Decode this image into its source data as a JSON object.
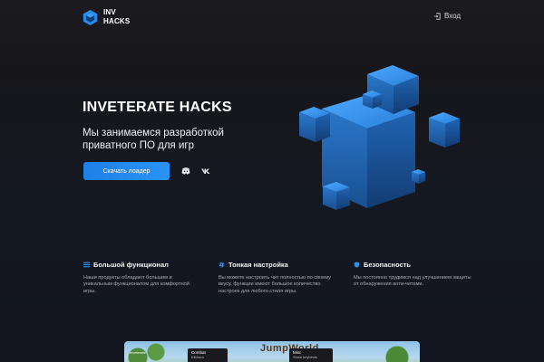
{
  "header": {
    "logo_text": "INV\nHACKS",
    "login_label": "Вход"
  },
  "hero": {
    "title": "INVETERATE HACKS",
    "subtitle": "Мы занимаемся разработкой приватного ПО для игр",
    "cta_label": "Скачать лоадер",
    "social_icons": [
      "discord-icon",
      "vk-icon"
    ]
  },
  "features": [
    {
      "icon": "list-icon",
      "title": "Большой функционал",
      "description": "Наши продукты обладают большим и уникальным функционалом для комфортной игры."
    },
    {
      "icon": "gear-icon",
      "title": "Тонкая настройка",
      "description": "Вы можете настроить чит полностью по своему вкусу, функции имеют большое количество настроек для любого стиля игры."
    },
    {
      "icon": "shield-icon",
      "title": "Безопасность",
      "description": "Мы постоянно трудимся над улучшением защиты от обнаружения анти-читами."
    }
  ],
  "preview": {
    "logo_text": "JumpWorld",
    "panel_a_title": "Combat",
    "panel_a_item": "KillAura",
    "panel_b_title": "Misc",
    "panel_b_item": "Show keybinds",
    "left_label": "Inveterate"
  },
  "colors": {
    "accent": "#2b93f5",
    "background": "#17171b",
    "cube_blue": "#2d7fd6"
  }
}
